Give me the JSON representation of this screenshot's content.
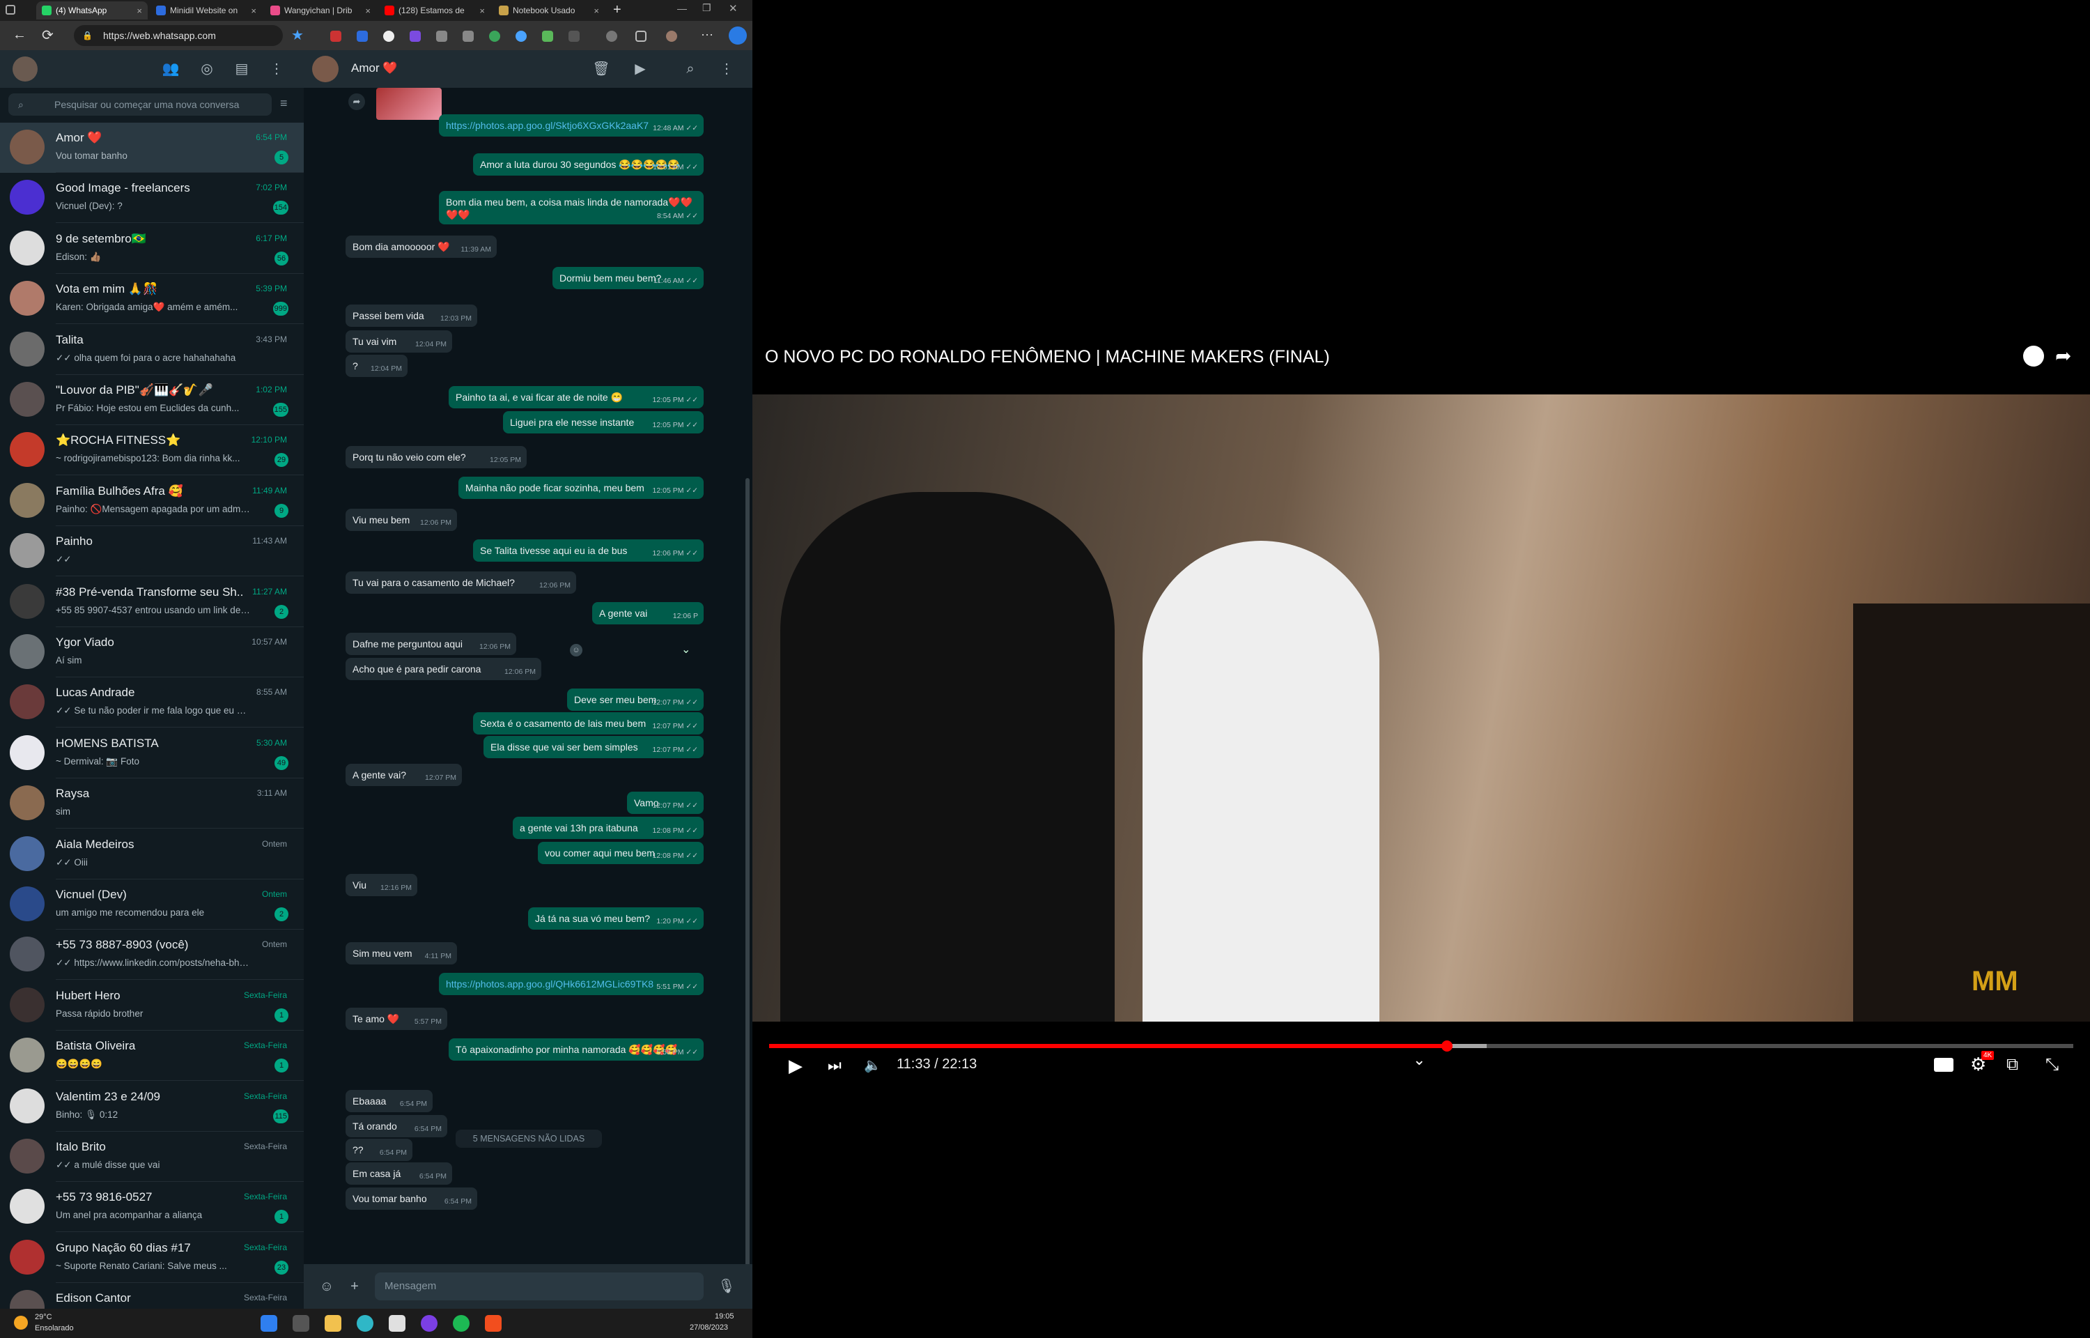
{
  "browser": {
    "tabs": [
      {
        "label": "(4) WhatsApp",
        "active": true,
        "favicon_color": "#25d366"
      },
      {
        "label": "Minidil Website on",
        "active": false,
        "favicon_color": "#2d6cdf"
      },
      {
        "label": "Wangyichan | Drib",
        "active": false,
        "favicon_color": "#ea4c89"
      },
      {
        "label": "(128) Estamos de",
        "active": false,
        "favicon_color": "#ff0000"
      },
      {
        "label": "Notebook Usado",
        "active": false,
        "favicon_color": "#c8a24a"
      }
    ],
    "new_tab_label": "+",
    "url": "https://web.whatsapp.com"
  },
  "sidebar": {
    "search_placeholder": "Pesquisar ou começar uma nova conversa",
    "chats": [
      {
        "name": "Amor ❤️",
        "preview": "Vou tomar banho",
        "time": "6:54 PM",
        "badge": "5",
        "selected": true,
        "avatar_color": "#7a5a4a"
      },
      {
        "name": "Good Image - freelancers",
        "preview": "Vicnuel (Dev): ?",
        "time": "7:02 PM",
        "badge": "154",
        "avatar_color": "#4b2fd1"
      },
      {
        "name": "9 de setembro🇧🇷",
        "preview": "Edison: 👍🏽",
        "time": "6:17 PM",
        "badge": "56",
        "avatar_color": "#dddddd"
      },
      {
        "name": "Vota em mim 🙏🎊",
        "preview": "Karen: Obrigada amiga❤️ amém e amém...",
        "time": "5:39 PM",
        "badge": "999",
        "avatar_color": "#b07a6a"
      },
      {
        "name": "Talita",
        "preview": "✓✓ olha quem foi para o acre hahahahaha",
        "time": "3:43 PM",
        "badge": "",
        "avatar_color": "#6b6b6b"
      },
      {
        "name": "\"Louvor da PIB\"🎻🎹🎸🎷🎤",
        "preview": "Pr Fábio: Hoje estou em Euclides da cunh...",
        "time": "1:02 PM",
        "badge": "155",
        "avatar_color": "#5a5050"
      },
      {
        "name": "⭐ROCHA FITNESS⭐",
        "preview": "~ rodrigojiramebispo123: Bom dia rinha kk...",
        "time": "12:10 PM",
        "badge": "29",
        "avatar_color": "#c43a2a"
      },
      {
        "name": "Família Bulhões Afra 🥰",
        "preview": "Painho: 🚫Mensagem apagada por um admin...",
        "time": "11:49 AM",
        "badge": "9",
        "avatar_color": "#8a7a60"
      },
      {
        "name": "Painho",
        "preview": "✓✓",
        "time": "11:43 AM",
        "badge": "",
        "avatar_color": "#9a9a9a"
      },
      {
        "name": "#38 Pré-venda Transforme seu Sh...",
        "preview": "+55 85 9907-4537 entrou usando um link de ...",
        "time": "11:27 AM",
        "badge": "2",
        "avatar_color": "#3a3a3a"
      },
      {
        "name": "Ygor Viado",
        "preview": "Aí sim",
        "time": "10:57 AM",
        "badge": "",
        "avatar_color": "#6a7175"
      },
      {
        "name": "Lucas Andrade",
        "preview": "✓✓ Se tu não poder ir me fala logo que eu vou me ...",
        "time": "8:55 AM",
        "badge": "",
        "avatar_color": "#6a3a3a"
      },
      {
        "name": "HOMENS BATISTA",
        "preview": "~ Dermival: 📷 Foto",
        "time": "5:30 AM",
        "badge": "49",
        "avatar_color": "#e8e8ee"
      },
      {
        "name": "Raysa",
        "preview": "sim",
        "time": "3:11 AM",
        "badge": "",
        "avatar_color": "#8a6a50"
      },
      {
        "name": "Aiala Medeiros",
        "preview": "✓✓ Oiii",
        "time": "Ontem",
        "badge": "",
        "avatar_color": "#4a6aa0"
      },
      {
        "name": "Vicnuel (Dev)",
        "preview": "um amigo me recomendou para ele",
        "time": "Ontem",
        "badge": "2",
        "avatar_color": "#2a4a8a"
      },
      {
        "name": "+55 73 8887-8903 (você)",
        "preview": "✓✓ https://www.linkedin.com/posts/neha-bhardwaj...",
        "time": "Ontem",
        "badge": "",
        "avatar_color": "#505560"
      },
      {
        "name": "Hubert Hero",
        "preview": "Passa rápido brother",
        "time": "Sexta-Feira",
        "badge": "1",
        "avatar_color": "#3a3030"
      },
      {
        "name": "Batista Oliveira",
        "preview": "😄😄😄😄",
        "time": "Sexta-Feira",
        "badge": "1",
        "avatar_color": "#9a9a90"
      },
      {
        "name": "Valentim 23 e 24/09",
        "preview": "Binho: 🎙 0:12",
        "time": "Sexta-Feira",
        "badge": "115",
        "avatar_color": "#dddddd"
      },
      {
        "name": "Italo Brito",
        "preview": "✓✓ a mulé disse que vai",
        "time": "Sexta-Feira",
        "badge": "",
        "avatar_color": "#5a4a4a"
      },
      {
        "name": "+55 73 9816-0527",
        "preview": "Um anel pra acompanhar a aliança",
        "time": "Sexta-Feira",
        "badge": "1",
        "avatar_color": "#e0e0e0"
      },
      {
        "name": "Grupo Nação 60 dias #17",
        "preview": "~ Suporte Renato Cariani: Salve meus ...",
        "time": "Sexta-Feira",
        "badge": "23",
        "avatar_color": "#b03030"
      },
      {
        "name": "Edison Cantor",
        "preview": "",
        "time": "Sexta-Feira",
        "badge": "",
        "avatar_color": "#5a5050"
      }
    ]
  },
  "conversation": {
    "contact_name": "Amor ❤️",
    "unread_divider": "5 MENSAGENS NÃO LIDAS",
    "composer_placeholder": "Mensagem",
    "messages": [
      {
        "dir": "out",
        "text": "https://photos.app.goo.gl/Sktjo6XGxGKk2aaK7",
        "time": "12:48 AM ✓✓",
        "link": true
      },
      {
        "dir": "out",
        "text": "Amor a luta durou 30 segundos 😂😂😂😂😂",
        "time": "12:51 AM ✓✓"
      },
      {
        "dir": "out",
        "text": "Bom dia meu bem, a coisa mais linda de namorada❤️❤️",
        "time": "8:54 AM ✓✓",
        "text2": "❤️❤️"
      },
      {
        "dir": "in",
        "text": "Bom dia amooooor ❤️",
        "time": "11:39 AM"
      },
      {
        "dir": "out",
        "text": "Dormiu bem meu bem?",
        "time": "11:46 AM ✓✓"
      },
      {
        "dir": "in",
        "text": "Passei bem vida",
        "time": "12:03 PM"
      },
      {
        "dir": "in",
        "text": "Tu vai vim",
        "time": "12:04 PM"
      },
      {
        "dir": "in",
        "text": "?",
        "time": "12:04 PM"
      },
      {
        "dir": "out",
        "text": "Painho ta ai, e vai ficar ate de noite 😁",
        "time": "12:05 PM ✓✓"
      },
      {
        "dir": "out",
        "text": "Liguei pra ele nesse instante",
        "time": "12:05 PM ✓✓"
      },
      {
        "dir": "in",
        "text": "Porq tu não veio com ele?",
        "time": "12:05 PM"
      },
      {
        "dir": "out",
        "text": "Mainha não pode ficar sozinha, meu bem",
        "time": "12:05 PM ✓✓"
      },
      {
        "dir": "in",
        "text": "Viu meu bem",
        "time": "12:06 PM"
      },
      {
        "dir": "out",
        "text": "Se Talita tivesse aqui eu ia de bus",
        "time": "12:06 PM ✓✓"
      },
      {
        "dir": "in",
        "text": "Tu vai para o casamento de Michael?",
        "time": "12:06 PM"
      },
      {
        "dir": "out",
        "text": "A gente vai",
        "time": "12:06 P"
      },
      {
        "dir": "in",
        "text": "Dafne me perguntou aqui",
        "time": "12:06 PM"
      },
      {
        "dir": "in",
        "text": "Acho que é para pedir carona",
        "time": "12:06 PM"
      },
      {
        "dir": "out",
        "text": "Deve ser meu bem",
        "time": "12:07 PM ✓✓"
      },
      {
        "dir": "out",
        "text": "Sexta é o casamento de lais meu bem",
        "time": "12:07 PM ✓✓"
      },
      {
        "dir": "out",
        "text": "Ela disse que vai ser bem simples",
        "time": "12:07 PM ✓✓"
      },
      {
        "dir": "in",
        "text": "A gente vai?",
        "time": "12:07 PM"
      },
      {
        "dir": "out",
        "text": "Vamo",
        "time": "12:07 PM ✓✓"
      },
      {
        "dir": "out",
        "text": "a gente vai 13h pra itabuna",
        "time": "12:08 PM ✓✓"
      },
      {
        "dir": "out",
        "text": "vou comer aqui meu bem",
        "time": "12:08 PM ✓✓"
      },
      {
        "dir": "in",
        "text": "Viu",
        "time": "12:16 PM"
      },
      {
        "dir": "out",
        "text": "Já tá na sua vó meu bem?",
        "time": "1:20 PM ✓✓"
      },
      {
        "dir": "in",
        "text": "Sim meu vem",
        "time": "4:11 PM"
      },
      {
        "dir": "out",
        "text": "https://photos.app.goo.gl/QHk6612MGLic69TK8",
        "time": "5:51 PM ✓✓",
        "link": true
      },
      {
        "dir": "in",
        "text": "Te amo ❤️",
        "time": "5:57 PM"
      },
      {
        "dir": "out",
        "text": "Tô apaixonadinho por minha namorada 🥰🥰🥰🥰",
        "time": "5:58 PM ✓✓"
      },
      {
        "dir": "in",
        "text": "Ebaaaa",
        "time": "6:54 PM"
      },
      {
        "dir": "in",
        "text": "Tá orando",
        "time": "6:54 PM"
      },
      {
        "dir": "in",
        "text": "??",
        "time": "6:54 PM"
      },
      {
        "dir": "in",
        "text": "Em casa já",
        "time": "6:54 PM"
      },
      {
        "dir": "in",
        "text": "Vou tomar banho",
        "time": "6:54 PM"
      }
    ]
  },
  "taskbar": {
    "temperature": "29°C",
    "weather": "Ensolarado",
    "clock_time": "19:05",
    "clock_date": "27/08/2023"
  },
  "youtube": {
    "title": "O NOVO PC DO RONALDO FENÔMENO | MACHINE MAKERS (FINAL)",
    "time_display": "11:33 / 22:13",
    "progress_fraction": 0.52,
    "buffered_fraction": 0.55,
    "quality_badge": "4K",
    "watermark": "MM"
  },
  "colors": {
    "wa_accent": "#00a884",
    "wa_outgoing": "#005c4b",
    "wa_incoming": "#202c33",
    "yt_red": "#ff0000"
  }
}
